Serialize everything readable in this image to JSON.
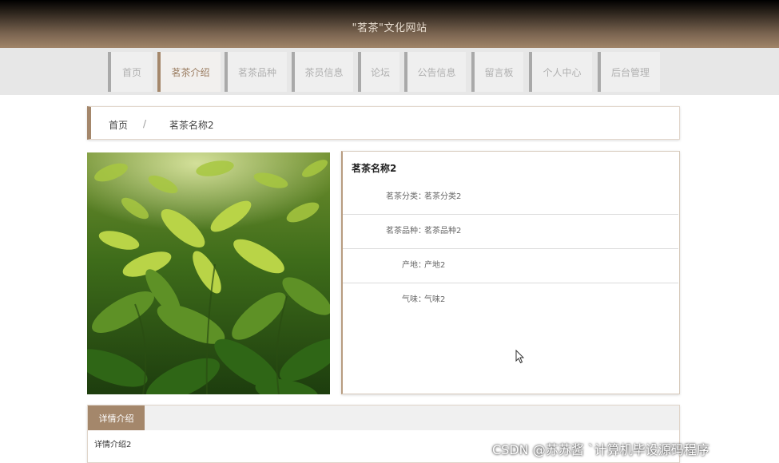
{
  "header": {
    "site_title": "\"茗茶\"文化网站"
  },
  "nav": {
    "items": [
      {
        "label": "首页"
      },
      {
        "label": "茗茶介绍",
        "active": true
      },
      {
        "label": "茗茶品种"
      },
      {
        "label": "茶员信息"
      },
      {
        "label": "论坛"
      },
      {
        "label": "公告信息"
      },
      {
        "label": "留言板"
      },
      {
        "label": "个人中心"
      },
      {
        "label": "后台管理"
      }
    ]
  },
  "breadcrumb": {
    "home": "首页",
    "separator": "/",
    "current": "茗茶名称2"
  },
  "detail": {
    "title": "茗茶名称2",
    "fields": [
      {
        "label": "茗茶分类：",
        "value": "茗茶分类2"
      },
      {
        "label": "茗茶品种：",
        "value": "茗茶品种2"
      },
      {
        "label": "产地：",
        "value": "产地2"
      },
      {
        "label": "气味：",
        "value": "气味2"
      }
    ]
  },
  "tabs": {
    "active_label": "详情介绍",
    "content": "详情介绍2"
  },
  "watermark": "CSDN @苏苏酱  ˋ计算机毕设源码程序",
  "colors": {
    "accent": "#a4876b",
    "nav_bg": "#e7e7e7"
  }
}
